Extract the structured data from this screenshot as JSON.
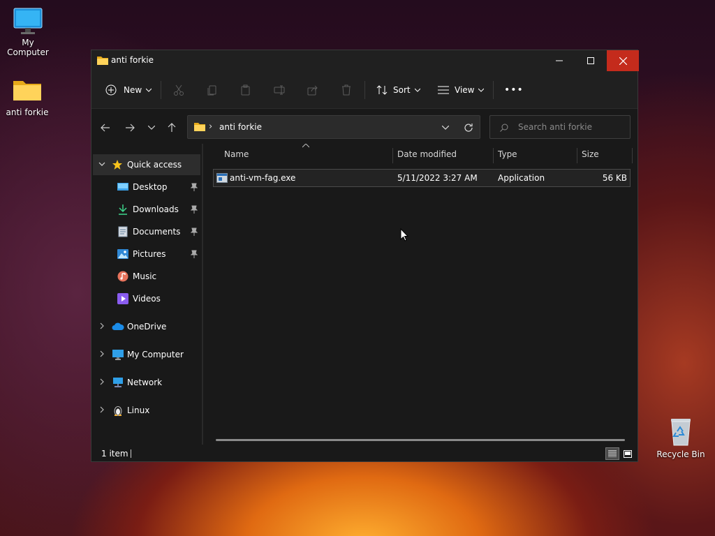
{
  "desktop": {
    "my_computer_label": "My Computer",
    "folder_label": "anti forkie",
    "recycle_bin_label": "Recycle Bin"
  },
  "window": {
    "title": "anti forkie",
    "minimize": "minimize",
    "maximize": "maximize",
    "close": "close"
  },
  "toolbar": {
    "new_label": "New",
    "sort_label": "Sort",
    "view_label": "View",
    "more_label": "•••"
  },
  "address": {
    "path": "anti forkie",
    "separator": "›"
  },
  "search": {
    "placeholder": "Search anti forkie"
  },
  "sidebar": {
    "items": [
      {
        "label": "Quick access"
      },
      {
        "label": "Desktop"
      },
      {
        "label": "Downloads"
      },
      {
        "label": "Documents"
      },
      {
        "label": "Pictures"
      },
      {
        "label": "Music"
      },
      {
        "label": "Videos"
      },
      {
        "label": "OneDrive"
      },
      {
        "label": "My Computer"
      },
      {
        "label": "Network"
      },
      {
        "label": "Linux"
      }
    ]
  },
  "columns": {
    "name": "Name",
    "date": "Date modified",
    "type": "Type",
    "size": "Size"
  },
  "files": [
    {
      "name": "anti-vm-fag.exe",
      "date": "5/11/2022 3:27 AM",
      "type": "Application",
      "size": "56 KB"
    }
  ],
  "status": {
    "count": "1 item"
  },
  "colors": {
    "accent": "#60cdff",
    "close_red": "#c42b1c",
    "folder_yellow": "#f4c542"
  }
}
